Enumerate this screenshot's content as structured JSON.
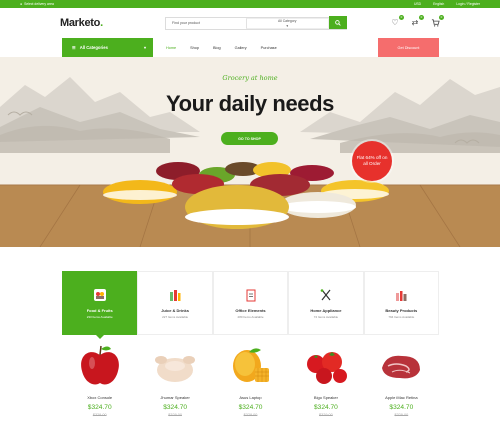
{
  "topbar": {
    "location": "Select delivery area",
    "currency": "USD",
    "language": "English",
    "account": "Login / Register"
  },
  "header": {
    "logo": "Marketo",
    "logo_dot": ".",
    "search_placeholder": "Find your product",
    "category_select": "All Category",
    "wishlist_count": "0",
    "compare_count": "0",
    "cart_count": "0"
  },
  "nav": {
    "all_categories": "All Categories",
    "items": [
      "Home",
      "Shop",
      "Blog",
      "Gallery",
      "Purchase"
    ],
    "active_index": 0,
    "cta": "Get Discount"
  },
  "hero": {
    "tagline": "Grocery at home",
    "headline": "Your daily needs",
    "button": "GO TO SHOP",
    "badge": "Flat 64% off on all Order"
  },
  "categories": [
    {
      "name": "Food & Fruits",
      "count": "233 Items Available",
      "icon": "fruit-basket-icon",
      "active": true
    },
    {
      "name": "Juice & Drinks",
      "count": "227 Items Available",
      "icon": "bottles-icon",
      "active": false
    },
    {
      "name": "Office Elements",
      "count": "280 Items Available",
      "icon": "clipboard-icon",
      "active": false
    },
    {
      "name": "Home Appliance",
      "count": "74 Items Available",
      "icon": "utensils-icon",
      "active": false
    },
    {
      "name": "Beauty Products",
      "count": "794 Items Available",
      "icon": "cosmetics-icon",
      "active": false
    }
  ],
  "products": [
    {
      "name": "Xbox Console",
      "price": "$324.70",
      "old_price": "$329.00",
      "image": "apple"
    },
    {
      "name": "Jhumar Speaker",
      "price": "$324.70",
      "old_price": "$329.00",
      "image": "raw-chicken"
    },
    {
      "name": "Asus Laptop",
      "price": "$324.70",
      "old_price": "$329.00",
      "image": "mango"
    },
    {
      "name": "Bigo Speaker",
      "price": "$324.70",
      "old_price": "$329.00",
      "image": "tomatoes"
    },
    {
      "name": "Apple iMac Retina",
      "price": "$324.70",
      "old_price": "$329.00",
      "image": "raw-meat"
    }
  ],
  "colors": {
    "brand": "#4caf1e",
    "discount": "#f56d6d",
    "badge": "#e7312c"
  }
}
